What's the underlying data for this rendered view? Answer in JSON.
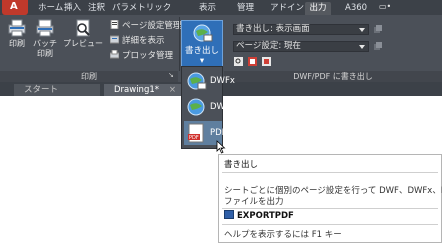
{
  "ribbon_tabs": [
    "ホーム",
    "挿入",
    "注釈",
    "パラメトリック",
    "表示",
    "管理",
    "出力",
    "アドイン",
    "A360"
  ],
  "ribbon_tab_dropdown": "▭•",
  "print_panel": {
    "title": "印刷",
    "print_label": "印刷",
    "batch_label_1": "バッチ",
    "batch_label_2": "印刷",
    "preview_label": "プレビュー",
    "page_setup_label": "ページ設定管理",
    "details_label": "詳細を表示",
    "plotter_label": "プロッタ管理",
    "launcher": "↘"
  },
  "export_panel": {
    "title": "DWF/PDF に書き出し",
    "export_label_1": "書き出し",
    "export_label_2": "▾",
    "export_field": "書き出し: 表示画面",
    "page_setup_field": "ページ設定: 現在"
  },
  "doc_tabs": {
    "start": "スタート",
    "drawing": "Drawing1*",
    "close": "×"
  },
  "menu": {
    "items": [
      "DWFx",
      "DWF",
      "PDF"
    ]
  },
  "tooltip": {
    "title": "書き出し",
    "desc_1": "シートごとに個別のページ設定を行って DWF、DWFx、PDF",
    "desc_2": "ファイルを出力",
    "command": "EXPORTPDF",
    "help": "ヘルプを表示するには F1 キー"
  },
  "colors": {
    "ribbon_bg": "#4b5058",
    "tab_bar_bg": "#3c4148",
    "export_button_bg": "#2f6fb8",
    "app_button": "#c0392b"
  }
}
